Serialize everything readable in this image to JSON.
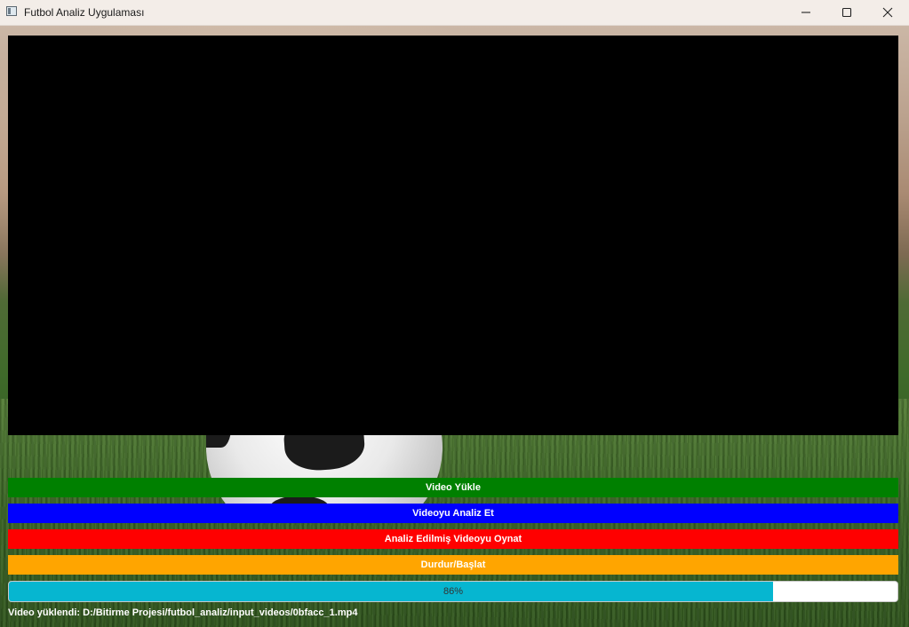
{
  "window": {
    "title": "Futbol Analiz Uygulaması",
    "controls": [
      "minimize-icon",
      "maximize-icon",
      "close-icon"
    ]
  },
  "buttons": {
    "load_video": {
      "label": "Video Yükle",
      "color": "#008000"
    },
    "analyze_video": {
      "label": "Videoyu Analiz Et",
      "color": "#0000ff"
    },
    "play_analyzed": {
      "label": "Analiz Edilmiş Videoyu Oynat",
      "color": "#ff0000"
    },
    "pause_play": {
      "label": "Durdur/Başlat",
      "color": "#ffa500"
    }
  },
  "progress": {
    "value": 86,
    "label": "86%",
    "color": "#06b6d0"
  },
  "status": {
    "text": "Video yüklendi: D:/Bitirme Projesi/futbol_analiz/input_videos/0bfacc_1.mp4"
  }
}
